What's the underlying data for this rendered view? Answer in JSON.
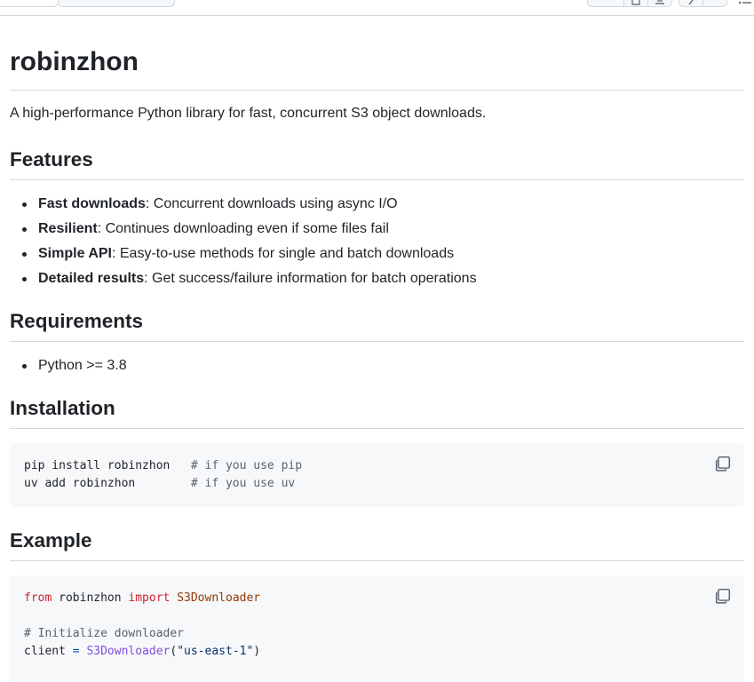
{
  "readme": {
    "title": "robinzhon",
    "intro": "A high-performance Python library for fast, concurrent S3 object downloads.",
    "features": {
      "heading": "Features",
      "items": [
        {
          "bold": "Fast downloads",
          "rest": ": Concurrent downloads using async I/O"
        },
        {
          "bold": "Resilient",
          "rest": ": Continues downloading even if some files fail"
        },
        {
          "bold": "Simple API",
          "rest": ": Easy-to-use methods for single and batch downloads"
        },
        {
          "bold": "Detailed results",
          "rest": ": Get success/failure information for batch operations"
        }
      ]
    },
    "requirements": {
      "heading": "Requirements",
      "items": [
        "Python >= 3.8"
      ]
    },
    "installation": {
      "heading": "Installation",
      "lines": [
        {
          "cmd": "pip install robinzhon   ",
          "comment": "# if you use pip"
        },
        {
          "cmd": "uv add robinzhon        ",
          "comment": "# if you use uv"
        }
      ]
    },
    "example": {
      "heading": "Example",
      "kw_from": "from",
      "module": " robinzhon ",
      "kw_import": "import",
      "class_name": " S3Downloader",
      "comment": "# Initialize downloader",
      "var": "client ",
      "assign": "=",
      "call": " S3Downloader",
      "paren_open": "(",
      "arg": "\"us-east-1\"",
      "paren_close": ")"
    }
  },
  "icons": {
    "copy": "copy-icon",
    "outline": "list-unordered-icon",
    "download": "download-icon",
    "edit": "pencil-icon"
  },
  "colors": {
    "text": "#1f2328",
    "border": "#d1d9e0",
    "code_bg": "#f6f8fa",
    "comment": "#59636e",
    "keyword": "#cf222e",
    "string": "#0a3069"
  }
}
